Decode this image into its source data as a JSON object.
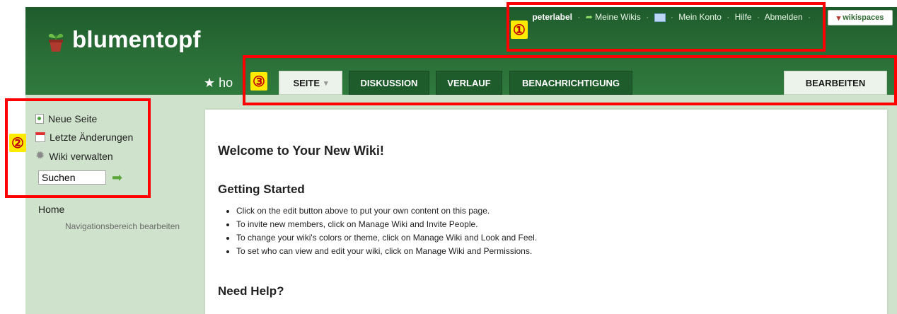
{
  "header": {
    "logo_text": "blumentopf",
    "user": "peterlabel",
    "links": [
      "Meine Wikis",
      "Mein Konto",
      "Hilfe",
      "Abmelden"
    ],
    "brand_badge": "wikispaces",
    "page_title": "★ ho"
  },
  "tabs": [
    {
      "label": "SEITE",
      "chevron": "▾"
    },
    {
      "label": "DISKUSSION"
    },
    {
      "label": "VERLAUF"
    },
    {
      "label": "BENACHRICHTIGUNG"
    },
    {
      "label": "BEARBEITEN"
    }
  ],
  "sidebar": {
    "items": [
      {
        "label": "Neue Seite",
        "icon": "new-page-icon"
      },
      {
        "label": "Letzte Änderungen",
        "icon": "calendar-icon"
      },
      {
        "label": "Wiki verwalten",
        "icon": "gear-icon"
      }
    ],
    "search_value": "Suchen",
    "nav_link": "Home",
    "nav_edit": "Navigationsbereich bearbeiten"
  },
  "content": {
    "welcome": "Welcome to Your New Wiki!",
    "getting_started": "Getting Started",
    "bullets": [
      "Click on the edit button above to put your own content on this page.",
      "To invite new members, click on Manage Wiki and Invite People.",
      "To change your wiki's colors or theme, click on Manage Wiki and Look and Feel.",
      "To set who can view and edit your wiki, click on Manage Wiki and Permissions."
    ],
    "need_help": "Need Help?"
  },
  "annotations": [
    "①",
    "②",
    "③"
  ],
  "colors": {
    "header_green": "#2a6e37",
    "tab_dark": "#1f5c2c",
    "sidebar_bg": "#cfe3cc",
    "callout_red": "#ff0000",
    "badge_yellow": "#ffeb00"
  }
}
